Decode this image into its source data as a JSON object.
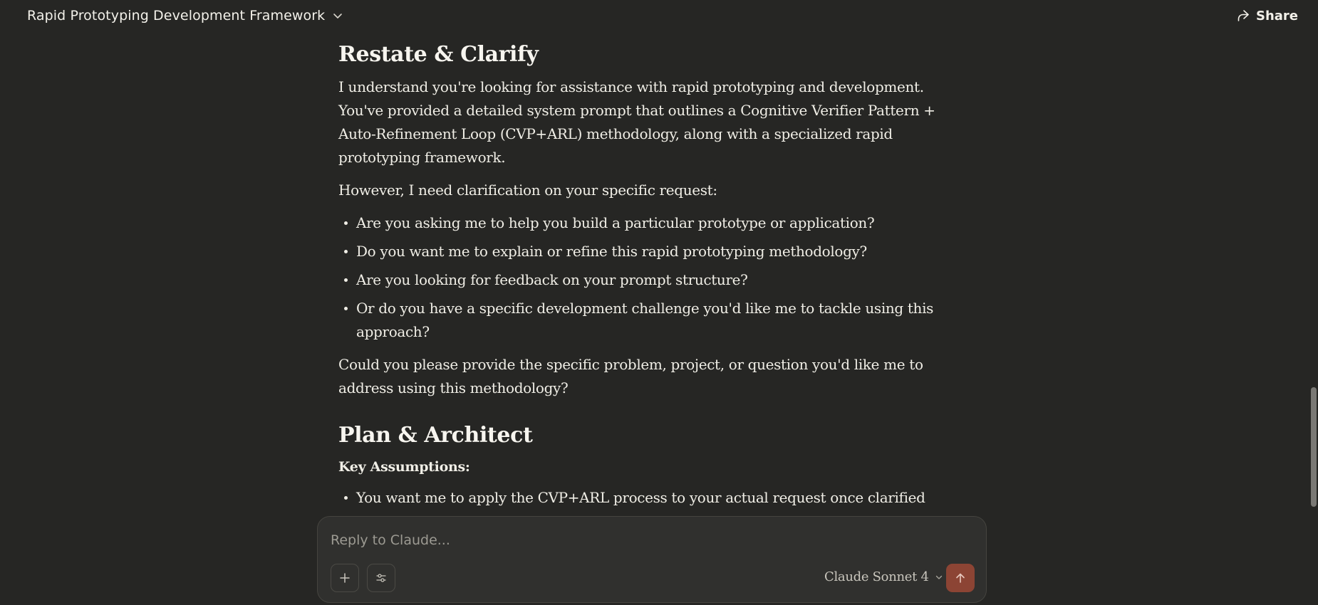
{
  "header": {
    "title": "Rapid Prototyping Development Framework",
    "share_label": "Share"
  },
  "message": {
    "section1_heading": "Restate & Clarify",
    "para1": "I understand you're looking for assistance with rapid prototyping and development. You've provided a detailed system prompt that outlines a Cognitive Verifier Pattern + Auto-Refinement Loop (CVP+ARL) methodology, along with a specialized rapid prototyping framework.",
    "para2": "However, I need clarification on your specific request:",
    "bullets": [
      "Are you asking me to help you build a particular prototype or application?",
      "Do you want me to explain or refine this rapid prototyping methodology?",
      "Are you looking for feedback on your prompt structure?",
      "Or do you have a specific development challenge you'd like me to tackle using this approach?"
    ],
    "para3": "Could you please provide the specific problem, project, or question you'd like me to address using this methodology?",
    "section2_heading": "Plan & Architect",
    "key_assumptions_label": "Key Assumptions:",
    "assumption_bullets": [
      "You want me to apply the CVP+ARL process to your actual request once clarified"
    ]
  },
  "composer": {
    "placeholder": "Reply to Claude...",
    "model_label": "Claude Sonnet 4"
  },
  "colors": {
    "background": "#262624",
    "composer_bg": "#30302e",
    "send_button": "#8c4434",
    "text": "#f0eee6"
  },
  "icons": {
    "title_dropdown": "chevron-down-icon",
    "share": "share-icon",
    "add": "plus-icon",
    "tools": "sliders-icon",
    "model_dropdown": "chevron-down-icon",
    "send": "arrow-up-icon"
  }
}
